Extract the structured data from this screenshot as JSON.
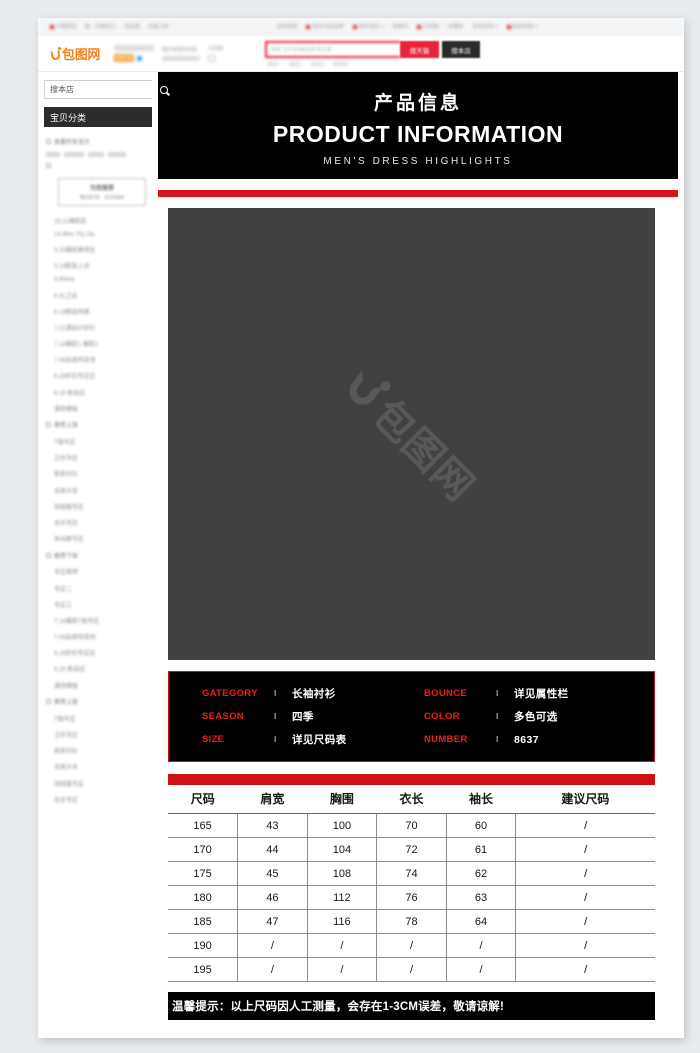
{
  "top_nav": {
    "left_items": [
      "中国质造",
      "喵 - 天猫双11",
      "淘宝网",
      "天猫上新"
    ],
    "right_items": [
      "请您登录",
      "我关注的品牌",
      "我的淘宝 ▾",
      "购物车",
      "手机版",
      "收藏夹",
      "商家支持 ▾",
      "网站导航 ▾"
    ]
  },
  "header": {
    "logo_text": "包图网",
    "logo_badge": "旗舰店铺",
    "shop_line1": "最近搜索的商家",
    "shop_line2": "手机版",
    "search": {
      "value": "",
      "placeholder": "搜索 宝贝/店铺/品牌/淘宝客",
      "btn_tmall": "搜天猫",
      "btn_shop": "搜本店"
    },
    "hot_words": [
      "热词一",
      "热词二",
      "热词三",
      "热词四"
    ]
  },
  "sidebar": {
    "search": {
      "value": "搜本店",
      "placeholder": "搜本店",
      "icon": "search-icon"
    },
    "category_header": "宝贝分类",
    "group_title": "查看所有宝贝",
    "chips": [
      14,
      20,
      16,
      18
    ],
    "promo": {
      "line1": "为您推荐",
      "line2": "每日8:00 - 10:00AM"
    },
    "items_1": [
      "15.11爆款区",
      "14.8fen Thj Ula",
      "5.20爆款推荐区",
      "9.19新款上衣",
      "9.8New",
      "9.31卫衣",
      "8.19精选特惠",
      "7.21潮品针织衫",
      "7.14爆款1 爆款2",
      "7.06品类特卖场",
      "6.28折扣专区区",
      "6.15 新品区",
      "通用模板"
    ],
    "group2_title": "推荐上架",
    "items_2": [
      "T恤专区",
      "卫衣专区",
      "新款衬衫",
      "毛呢大衣",
      "羽绒服专区",
      "毛衣专区",
      "休闲裤专区"
    ],
    "group3_title": "推荐下架",
    "items_3": [
      "专区推荐",
      "专区二",
      "专区三",
      "7.14爆款T恤专区",
      "7.06品类特卖场",
      "6.28折扣专区区",
      "6.15 新品区",
      "通用模板"
    ],
    "group4_title": "推荐上架",
    "items_4": [
      "T恤专区",
      "卫衣专区",
      "新款衬衫",
      "毛呢大衣",
      "羽绒服专区",
      "毛衣专区"
    ]
  },
  "hero": {
    "title_cn": "产品信息",
    "title_en": "PRODUCT INFORMATION",
    "subtitle": "MEN'S DRESS HIGHLIGHTS"
  },
  "product_image": {
    "watermark_text": "包图网",
    "watermark_mark": "b-logo-mark"
  },
  "spec_panel": {
    "rows": [
      {
        "key_l": "GATEGORY",
        "val_l": "长袖衬衫",
        "key_r": "BOUNCE",
        "val_r": "详见属性栏"
      },
      {
        "key_l": "SEASON",
        "val_l": "四季",
        "key_r": "COLOR",
        "val_r": "多色可选"
      },
      {
        "key_l": "SIZE",
        "val_l": "详见尺码表",
        "key_r": "NUMBER",
        "val_r": "8637"
      }
    ],
    "separator": "I"
  },
  "size_table": {
    "headers": [
      "尺码",
      "肩宽",
      "胸围",
      "衣长",
      "袖长",
      "建议尺码"
    ],
    "rows": [
      [
        "165",
        "43",
        "100",
        "70",
        "60",
        "/"
      ],
      [
        "170",
        "44",
        "104",
        "72",
        "61",
        "/"
      ],
      [
        "175",
        "45",
        "108",
        "74",
        "62",
        "/"
      ],
      [
        "180",
        "46",
        "112",
        "76",
        "63",
        "/"
      ],
      [
        "185",
        "47",
        "116",
        "78",
        "64",
        "/"
      ],
      [
        "190",
        "/",
        "/",
        "/",
        "/",
        "/"
      ],
      [
        "195",
        "/",
        "/",
        "/",
        "/",
        "/"
      ]
    ],
    "note": "温馨提示：以上尺码因人工测量，会存在1-3CM误差，敬请谅解!"
  },
  "colors": {
    "brand_orange": "#f5821f",
    "accent_red": "#d6121c",
    "spec_red": "#ee1b24",
    "black": "#000000",
    "placeholder_gray": "#414141",
    "tmall_red": "#e8243c"
  }
}
